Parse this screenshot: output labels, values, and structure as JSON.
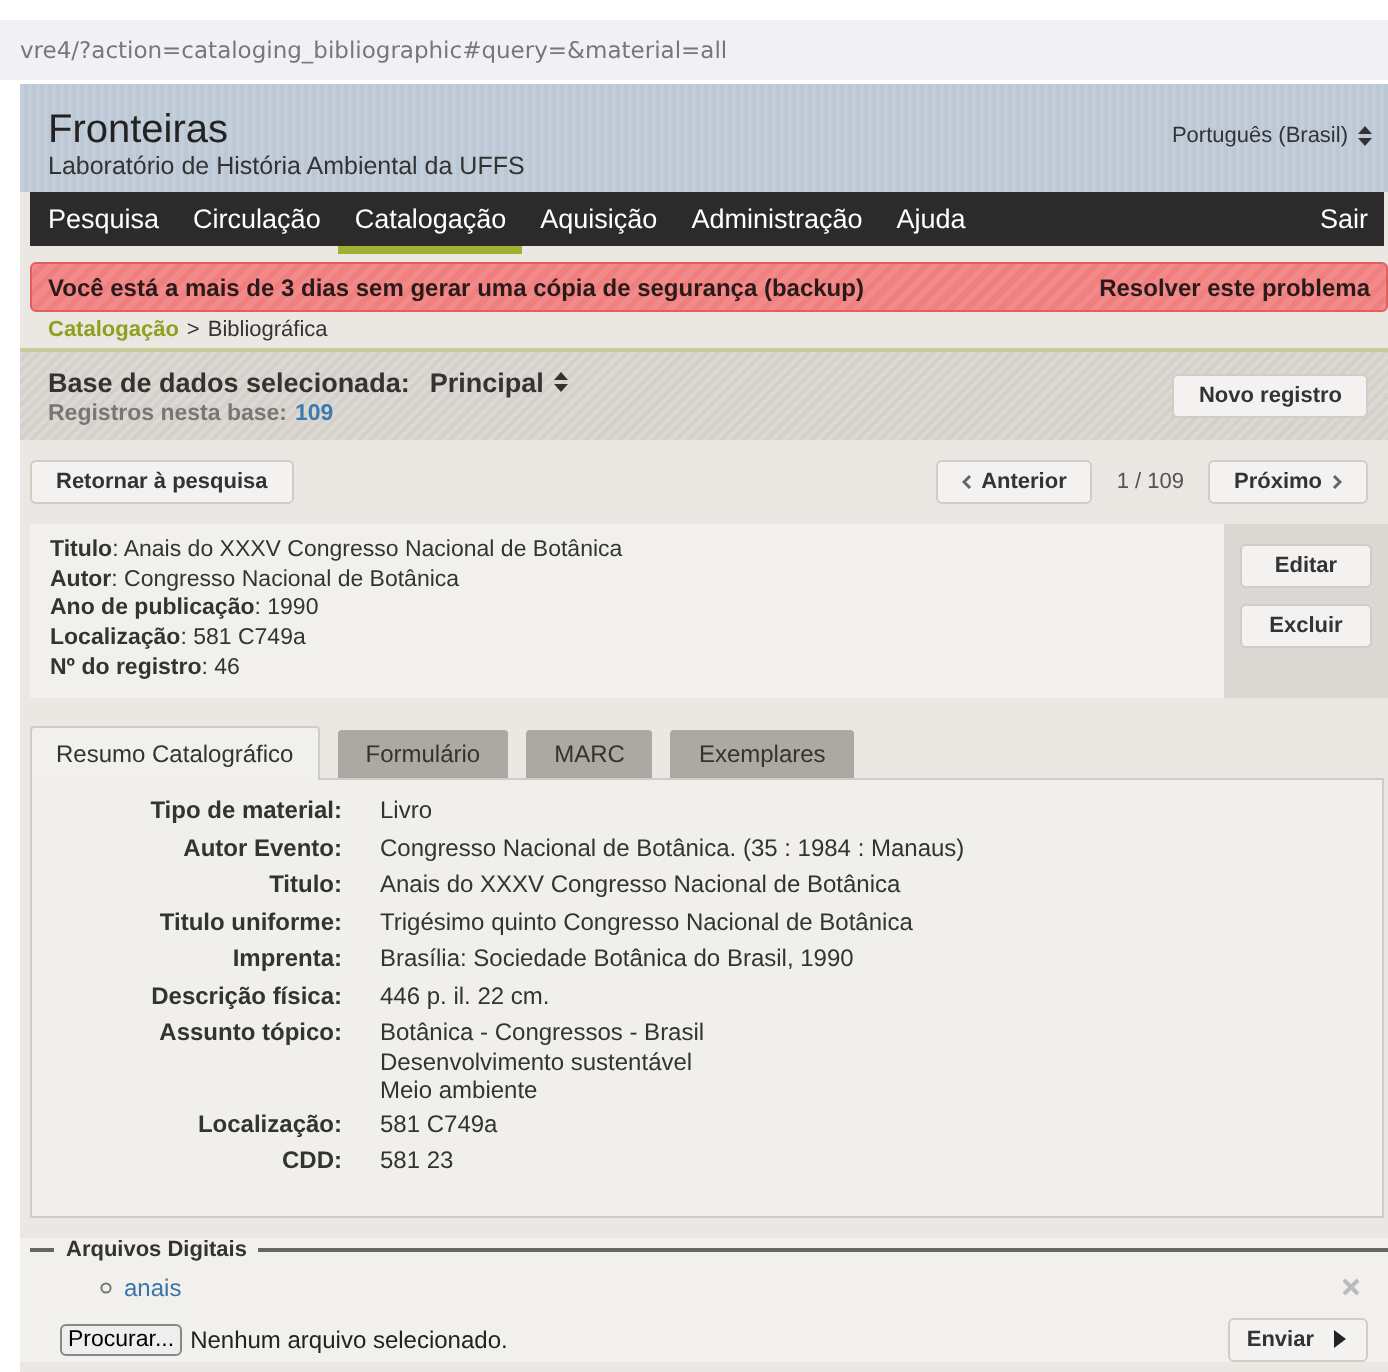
{
  "address_bar": {
    "url": "vre4/?action=cataloging_bibliographic#query=&material=all"
  },
  "header": {
    "title": "Fronteiras",
    "subtitle": "Laboratório de História Ambiental da UFFS",
    "language": "Português (Brasil)"
  },
  "nav": {
    "items": [
      {
        "label": "Pesquisa",
        "selected": false
      },
      {
        "label": "Circulação",
        "selected": false
      },
      {
        "label": "Catalogação",
        "selected": true
      },
      {
        "label": "Aquisição",
        "selected": false
      },
      {
        "label": "Administração",
        "selected": false
      },
      {
        "label": "Ajuda",
        "selected": false
      }
    ],
    "logout": "Sair"
  },
  "alert": {
    "message": "Você está a mais de 3 dias sem gerar uma cópia de segurança (backup)",
    "action": "Resolver este problema"
  },
  "breadcrumb": {
    "parent": "Catalogação",
    "separator": ">",
    "current": "Bibliográfica"
  },
  "database": {
    "label": "Base de dados selecionada:",
    "value": "Principal",
    "count_label": "Registros nesta base:",
    "count": "109",
    "new_button": "Novo registro"
  },
  "pager": {
    "back_button": "Retornar à pesquisa",
    "previous": "Anterior",
    "position": "1 / 109",
    "next": "Próximo"
  },
  "record": {
    "fields": [
      "**Titulo**: Anais do XXXV Congresso Nacional de Botânica",
      "**Autor**: Congresso Nacional de Botânica",
      "**Ano de publicação**: 1990",
      "**Localização**: 581 C749a",
      "**Nº do registro**: 46"
    ],
    "buttons": [
      "Editar",
      "Excluir"
    ]
  },
  "tabs": [
    {
      "label": "Resumo Catalográfico",
      "selected": true
    },
    {
      "label": "Formulário",
      "selected": false
    },
    {
      "label": "MARC",
      "selected": false
    },
    {
      "label": "Exemplares",
      "selected": false
    }
  ],
  "details": [
    {
      "label": "Tipo de material:",
      "values": [
        "Livro"
      ]
    },
    {
      "label": "Autor Evento:",
      "values": [
        "Congresso Nacional de Botânica. (35 : 1984 : Manaus)"
      ]
    },
    {
      "label": "Titulo:",
      "values": [
        "Anais do XXXV Congresso Nacional de Botânica"
      ]
    },
    {
      "label": "Titulo uniforme:",
      "values": [
        "Trigésimo quinto Congresso Nacional de Botânica"
      ]
    },
    {
      "label": "Imprenta:",
      "values": [
        "Brasília: Sociedade Botânica do Brasil, 1990"
      ]
    },
    {
      "label": "Descrição física:",
      "values": [
        "446 p. il. 22 cm."
      ]
    },
    {
      "label": "Assunto tópico:",
      "values": [
        "Botânica - Congressos - Brasil",
        "Desenvolvimento sustentável",
        "Meio ambiente"
      ]
    },
    {
      "label": "Localização:",
      "values": [
        "581 C749a"
      ]
    },
    {
      "label": "CDD:",
      "values": [
        "581 23"
      ]
    }
  ],
  "digital_files": {
    "legend": "Arquivos Digitais",
    "files": [
      "anais"
    ],
    "browse_button": "Procurar...",
    "no_file": "Nenhum arquivo selecionado.",
    "send_button": "Enviar"
  }
}
